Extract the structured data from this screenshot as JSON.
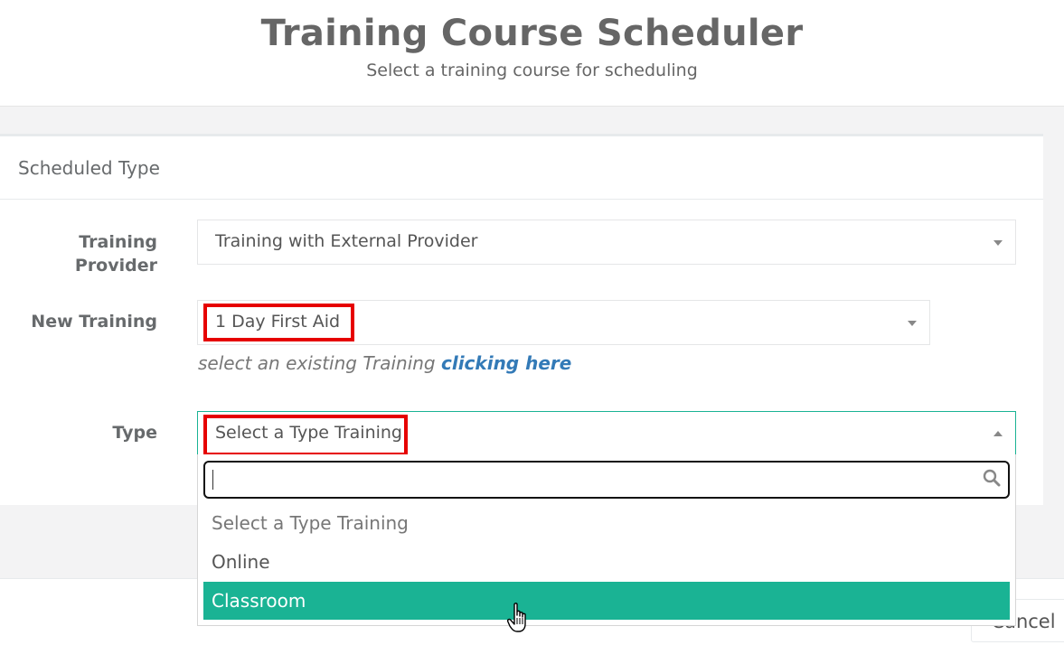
{
  "header": {
    "title": "Training Course Scheduler",
    "subtitle": "Select a training course for scheduling"
  },
  "panel": {
    "title": "Scheduled Type"
  },
  "form": {
    "provider_label_line1": "Training",
    "provider_label_line2": "Provider",
    "provider_value": "Training with External Provider",
    "new_training_label": "New Training",
    "new_training_value": "1 Day First Aid",
    "help_text": "select an existing Training",
    "help_link": "clicking here",
    "type_label": "Type",
    "type_value": "Select a Type Training"
  },
  "dropdown": {
    "search_value": "",
    "options": [
      {
        "label": "Select a Type Training",
        "state": "placeholder"
      },
      {
        "label": "Online",
        "state": "normal"
      },
      {
        "label": "Classroom",
        "state": "highlighted"
      }
    ]
  },
  "footer": {
    "cancel_label": "Cancel"
  },
  "colors": {
    "accent": "#1ab394",
    "link": "#337ab7",
    "annotation": "#e60000"
  },
  "icons": {
    "dropdown_arrow": "chevron-down-icon",
    "dropdown_arrow_open": "chevron-up-icon",
    "search": "search-icon",
    "cursor": "hand-pointer-icon"
  }
}
